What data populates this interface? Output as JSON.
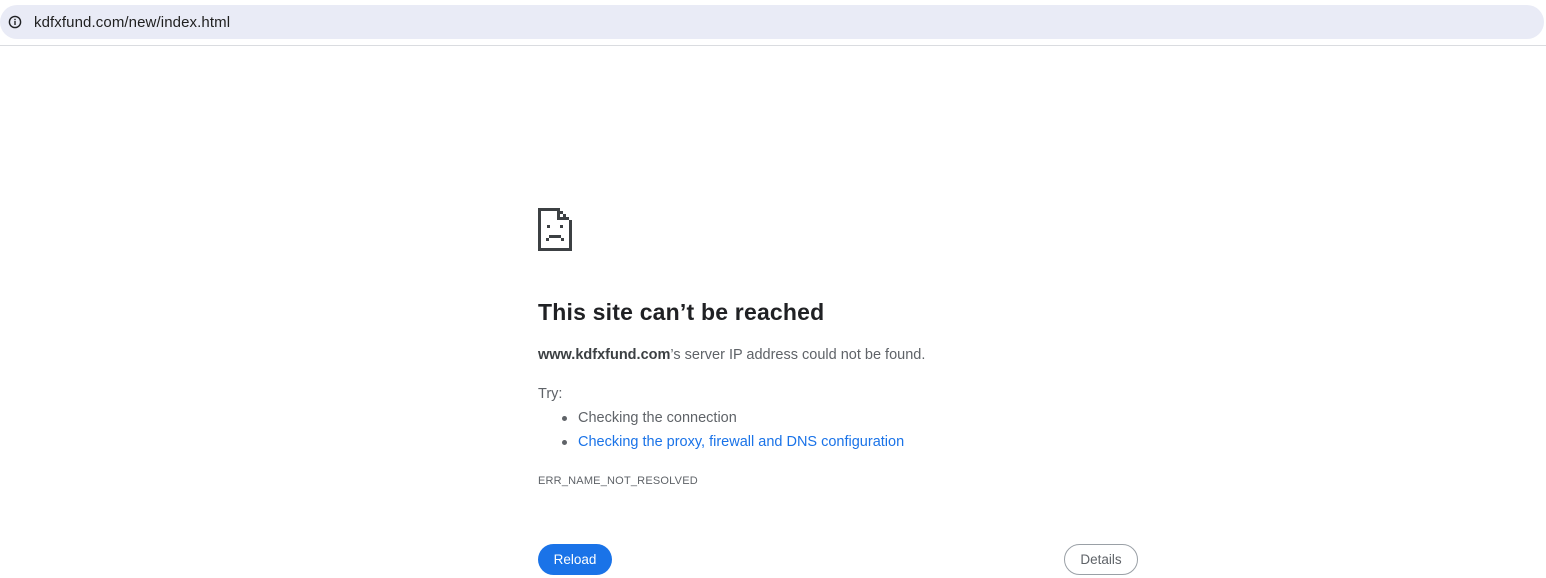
{
  "address_bar": {
    "url": "kdfxfund.com/new/index.html",
    "site_info_icon": "info-icon"
  },
  "error_page": {
    "icon": "sad-page-icon",
    "headline": "This site can’t be reached",
    "summary_host": "www.kdfxfund.com",
    "summary_rest": "’s server IP address could not be found.",
    "try_label": "Try:",
    "suggestions": [
      {
        "text": "Checking the connection",
        "is_link": false
      },
      {
        "text": "Checking the proxy, firewall and DNS configuration",
        "is_link": true
      }
    ],
    "error_code": "ERR_NAME_NOT_RESOLVED",
    "reload_label": "Reload",
    "details_label": "Details"
  },
  "colors": {
    "accent": "#1a73e8",
    "omnibox_bg": "#e9ebf6",
    "text_secondary": "#5f6368"
  }
}
